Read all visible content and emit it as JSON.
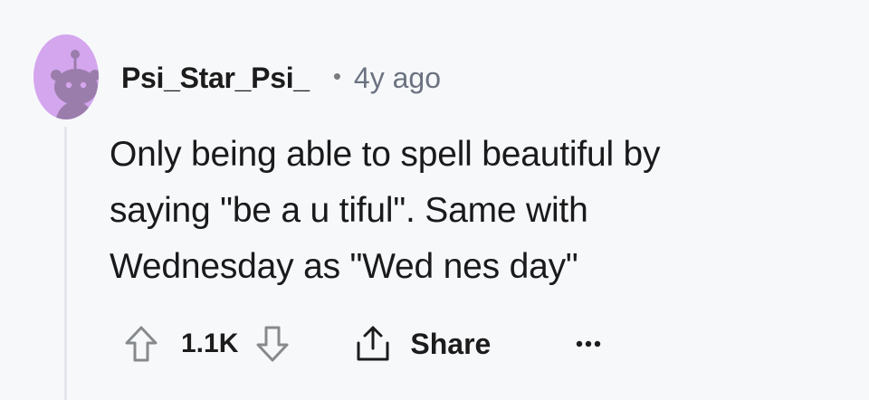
{
  "comment": {
    "author": "Psi_Star_Psi_",
    "separator": "•",
    "timestamp": "4y ago",
    "avatar_icon": "snoo-avatar-icon",
    "body_lines": [
      "Only being able to spell beautiful by",
      "saying \"be a u tiful\". Same with",
      "Wednesday as \"Wed nes day\""
    ]
  },
  "actions": {
    "upvote_icon": "upvote-arrow-icon",
    "vote_count": "1.1K",
    "downvote_icon": "downvote-arrow-icon",
    "share_icon": "share-upload-icon",
    "share_label": "Share",
    "more_icon": "ellipsis-icon"
  },
  "colors": {
    "background": "#f7f8fa",
    "avatar_bg": "#d4a6ee",
    "avatar_fg": "#9b7dac",
    "text": "#1a1a1b",
    "muted": "#6b7280",
    "icon": "#878a8c",
    "thread_line": "#e5e7eb"
  }
}
